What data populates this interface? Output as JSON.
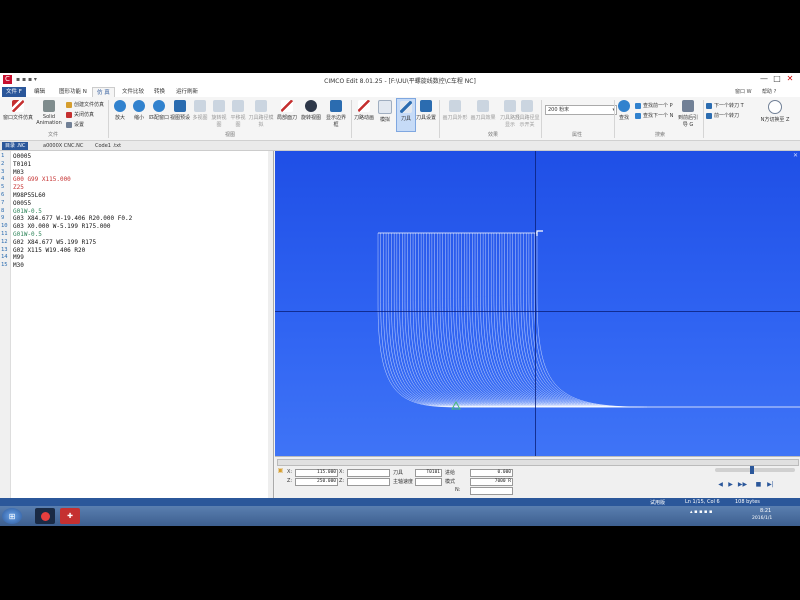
{
  "window": {
    "app_badge": "C",
    "quick_access": "▪ ▪ ▪ ▾",
    "title": "CIMCO Edit 8.01.25 - [F:\\UU\\平螺旋线数控\\C车程 NC]",
    "controls": [
      "—",
      "□",
      "✕"
    ]
  },
  "tabs": {
    "items": [
      "文件 F",
      "编辑",
      "图形功能 N",
      "仿 真",
      "文件比较",
      "转换",
      "运行刷新"
    ],
    "active_index": 3,
    "right_items": [
      "窗口 W",
      "帮助 ?"
    ]
  },
  "ribbon": {
    "file_group": {
      "label": "文件",
      "open_sim": "窗口文件仿真",
      "solid_anim": "Solid Animation",
      "create_sim": "创建文件仿真",
      "close_sim": "关闭仿真",
      "setup": "设置"
    },
    "view_group": {
      "label": "视图",
      "buttons": [
        "放大",
        "缩小",
        "匹配窗口",
        "视图预设",
        "多视图",
        "旋转视图",
        "平移视图",
        "刀具路径模拟",
        "局部面刀",
        "旋转视图",
        "显示边界框"
      ]
    },
    "tool_group": {
      "label": "",
      "buttons": [
        "刀路动画",
        "模拟",
        "刀具",
        "刀具设置"
      ]
    },
    "anim_group": {
      "label": "效果",
      "buttons": [
        "画刀具外形",
        "画刀具效果",
        "刀具路径显示",
        "刀具路径显示开关"
      ]
    },
    "attr_group": {
      "label": "属性",
      "combo_value": "200 粉末"
    },
    "nav_group": {
      "label": "搜索",
      "buttons": [
        "查找",
        "查找前一个 P",
        "查找下一个 N",
        "到前后引导 G"
      ]
    },
    "jump_group": {
      "label": "",
      "buttons": [
        "下一个转刀 T",
        "前一个转刀",
        "N方切换至 Z"
      ]
    }
  },
  "doc_tabs": [
    "目录 .NC",
    "a0000X CNC.NC",
    "Code1 .txt"
  ],
  "editor": {
    "lines": [
      {
        "n": "1",
        "code": "O0005",
        "color": "#111111"
      },
      {
        "n": "2",
        "code": "T0101",
        "color": "#111111"
      },
      {
        "n": "3",
        "code": "M03",
        "color": "#111111"
      },
      {
        "n": "4",
        "code": "G00 G99 X115.000",
        "color": "#c53030"
      },
      {
        "n": "5",
        "code": "Z25",
        "color": "#c53030"
      },
      {
        "n": "6",
        "code": "M98P55L60",
        "color": "#111111"
      },
      {
        "n": "7",
        "code": "O0055",
        "color": "#111111"
      },
      {
        "n": "8",
        "code": "G01W-0.5",
        "color": "#2f855a"
      },
      {
        "n": "9",
        "code": "G03 X84.677 W-19.406 R20.000 F0.2",
        "color": "#111111"
      },
      {
        "n": "10",
        "code": "G03 X0.000 W-5.199 R175.000",
        "color": "#111111"
      },
      {
        "n": "11",
        "code": "G01W-0.5",
        "color": "#2f855a"
      },
      {
        "n": "12",
        "code": "G02 X84.677 W5.199 R175",
        "color": "#111111"
      },
      {
        "n": "13",
        "code": "G02 X115 W19.406 R20",
        "color": "#111111"
      },
      {
        "n": "14",
        "code": "M99",
        "color": "#111111"
      },
      {
        "n": "15",
        "code": "M30",
        "color": "#111111"
      }
    ]
  },
  "viewport": {
    "close_glyph": "✕",
    "toolpath_passes": 60
  },
  "status_panel": {
    "x_label": "X:",
    "z_label": "Z:",
    "x_value": "115.000",
    "z_value": "250.000",
    "extra_label_1": "X:",
    "extra_label_2": "Z:",
    "tool_label": "刀具",
    "tool_value": "T0101",
    "feed_label": "进给",
    "feed_value": "0.000",
    "speed_label": "主轴速度",
    "speed_value": "",
    "mode_label": "模式",
    "mode_value": "",
    "s_label": "S:",
    "s_value": "7000 R",
    "n_label": "N:",
    "n_value": ""
  },
  "playback": {
    "buttons": [
      "◀",
      "▶",
      "▶▶",
      "■",
      "▶|"
    ]
  },
  "app_status": {
    "left": "",
    "right_mode": "试用版",
    "pos": "Ln 1/15, Col 6",
    "size": "108 bytes"
  },
  "taskbar": {
    "clock_time": "8:21",
    "clock_date": "2016/1/1"
  },
  "colors": {
    "accent": "#2b579a",
    "viewport": "#2f63f2",
    "toolpath": "#ffffff"
  }
}
